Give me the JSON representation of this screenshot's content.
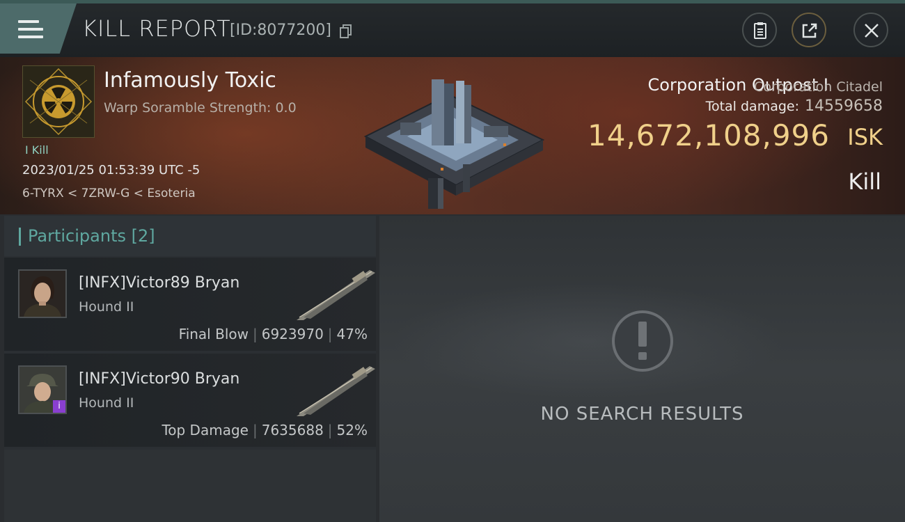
{
  "header": {
    "title": "KILL REPORT",
    "id_text": "[ID:8077200]"
  },
  "victim": {
    "name": "Infamously Toxic",
    "warp_scramble": "Warp Soramble Strength: 0.0",
    "kill_badge": "I Kill",
    "timestamp": "2023/01/25 01:53:39 UTC -5",
    "location": "6-TYRX < 7ZRW-G < Esoteria"
  },
  "target": {
    "name": "Corporation Outpost I",
    "type": "Corporation Citadel",
    "total_damage_label": "Total damage:",
    "total_damage_value": "14559658",
    "isk_value": "14,672,108,996",
    "isk_unit": "ISK",
    "status": "Kill"
  },
  "participants": {
    "title": "Participants [2]",
    "items": [
      {
        "name": "[INFX]Victor89 Bryan",
        "ship": "Hound II",
        "role": "Final Blow",
        "damage": "6923970",
        "percent": "47%"
      },
      {
        "name": "[INFX]Victor90 Bryan",
        "ship": "Hound II",
        "role": "Top Damage",
        "damage": "7635688",
        "percent": "52%"
      }
    ]
  },
  "results": {
    "empty_text": "NO SEARCH RESULTS"
  },
  "colors": {
    "accent_teal": "#5fa8a0",
    "isk_gold": "#f0d08a",
    "banner_red": "#5a3023"
  },
  "icons": [
    "menu-icon",
    "copy-icon",
    "clipboard-icon",
    "share-icon",
    "close-icon",
    "alert-icon",
    "info-badge-icon"
  ]
}
